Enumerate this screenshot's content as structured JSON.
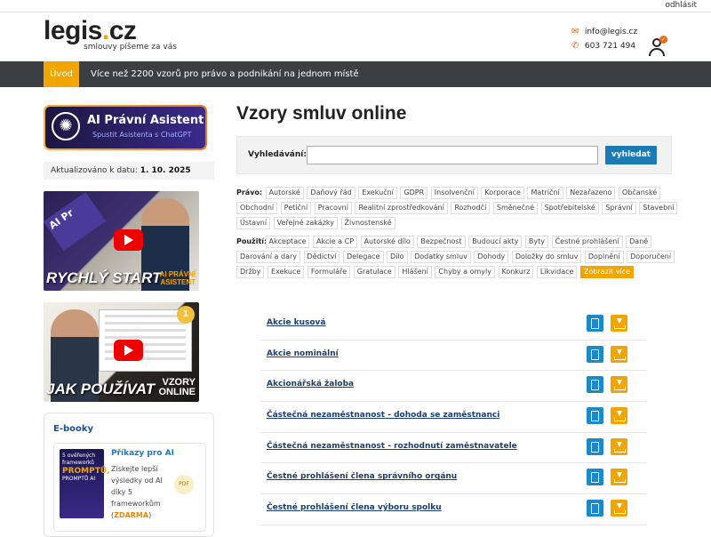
{
  "topbar": {
    "logout": "odhlásit"
  },
  "header": {
    "logo_main": "legis",
    "logo_dot": ".",
    "logo_tld": "cz",
    "tagline": "smlouvy píšeme za vás",
    "email": "info@legis.cz",
    "phone": "603 721 494",
    "user_badge": "✓"
  },
  "nav": {
    "home": "Úvod",
    "motto": "Více než 2200 vzorů pro právo a podnikání na jednom místě"
  },
  "sidebar": {
    "ai_title": "AI Právní Asistent",
    "ai_sub": "Spustit Asistenta s ChatGPT",
    "updated_label": "Aktualizováno k datu:",
    "updated_date": "1. 10. 2025",
    "video1": {
      "caption": "RYCHLÝ START",
      "caption2_a": "AI PRÁVNÍ",
      "caption2_b": "ASISTENT",
      "tag": "AI Pr"
    },
    "video2": {
      "caption": "JAK POUŽÍVAT",
      "caption2_a": "VZORY",
      "caption2_b": "ONLINE",
      "medal": "1"
    },
    "ebooks": {
      "heading": "E-booky",
      "item": {
        "cover_top": "5 ověřených frameworků",
        "cover_big": "PROMPTŮ,",
        "cover_sub": "PROMPTŮ AI",
        "title": "Příkazy pro AI",
        "desc": "Získejte lepší výsledky od AI díky 5 frameworkům",
        "free": "ZDARMA",
        "pdf": "PDF"
      }
    }
  },
  "main": {
    "title": "Vzory smluv online",
    "search_label": "Vyhledávání:",
    "search_value": "",
    "search_button": "vyhledat",
    "law_label": "Právo:",
    "law_tags": [
      "Autorské",
      "Daňový řád",
      "Exekuční",
      "GDPR",
      "Insolvenční",
      "Korporace",
      "Matriční",
      "Nezařazeno",
      "Občanské",
      "Obchodní",
      "Petiční",
      "Pracovní",
      "Realitní zprostředkování",
      "Rozhodčí",
      "Směnečné",
      "Spotřebitelské",
      "Správní",
      "Stavební",
      "Ústavní",
      "Veřejné zakázky",
      "Živnostenské"
    ],
    "use_label": "Použití:",
    "use_tags": [
      "Akceptace",
      "Akcie a CP",
      "Autorské dílo",
      "Bezpečnost",
      "Budoucí akty",
      "Byty",
      "Čestné prohlášení",
      "Daně",
      "Darování a dary",
      "Dědictví",
      "Delegace",
      "Dílo",
      "Dodatky smluv",
      "Dohody",
      "Doložky do smluv",
      "Doplnění",
      "Doporučení",
      "Držby",
      "Exekuce",
      "Formuláře",
      "Gratulace",
      "Hlášení",
      "Chyby a omyly",
      "Konkurz",
      "Likvidace"
    ],
    "show_more": "Zobrazit více",
    "documents": [
      "Akcie kusová",
      "Akcie nominální",
      "Akcionářská žaloba",
      "Částečná nezaměstnanost - dohoda se zaměstnanci",
      "Částečná nezaměstnanost - rozhodnutí zaměstnavatele",
      "Čestné prohlášení člena správního orgánu",
      "Čestné prohlášení člena výboru spolku"
    ]
  }
}
